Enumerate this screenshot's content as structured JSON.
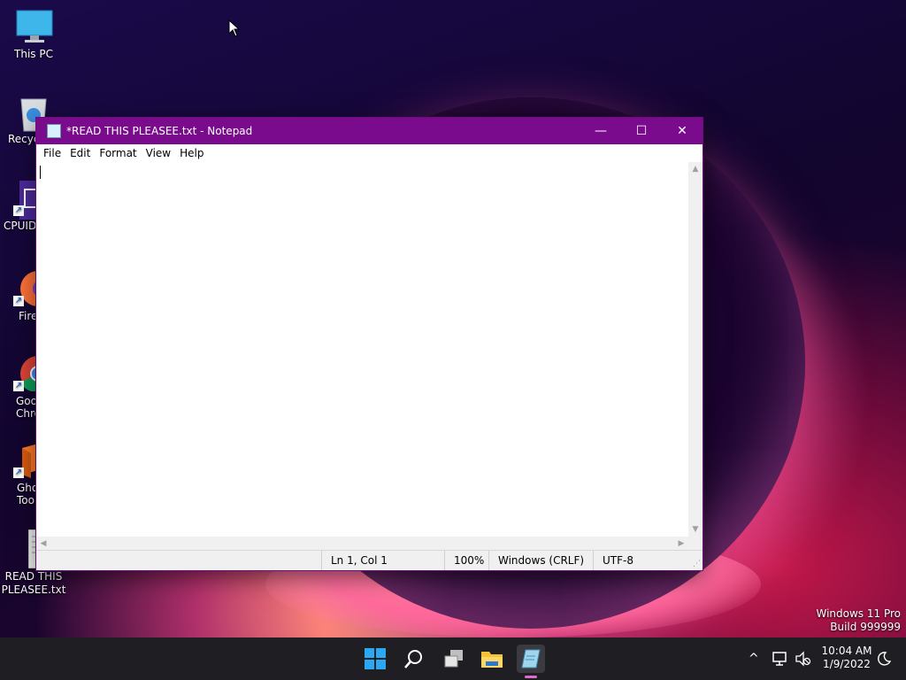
{
  "desktop": {
    "icons": [
      {
        "label": "This PC"
      },
      {
        "label": "Recyc"
      },
      {
        "label": "CPUID"
      },
      {
        "label": "Fire"
      },
      {
        "label": "Goo",
        "label2": "Chro"
      },
      {
        "label": "Gho",
        "label2": "Tool"
      },
      {
        "label": "READ THIS",
        "label2": "PLEASEE.txt"
      }
    ],
    "watermark_line1": "Windows 11 Pro",
    "watermark_line2": "Build 999999"
  },
  "notepad": {
    "title": "*READ THIS PLEASEE.txt - Notepad",
    "controls": {
      "minimize": "—",
      "maximize": "☐",
      "close": "✕"
    },
    "menu": [
      "File",
      "Edit",
      "Format",
      "View",
      "Help"
    ],
    "content": "",
    "status": {
      "position": "Ln 1, Col 1",
      "zoom": "100%",
      "line_ending": "Windows (CRLF)",
      "encoding": "UTF-8"
    },
    "title_bar_color": "#7a0b8c"
  },
  "taskbar": {
    "apps": [
      "start-icon",
      "search-icon",
      "task-view-icon",
      "file-explorer-icon",
      "notepad-icon"
    ],
    "clock_time": "10:04 AM",
    "clock_date": "1/9/2022",
    "tray_chevron": "^"
  }
}
